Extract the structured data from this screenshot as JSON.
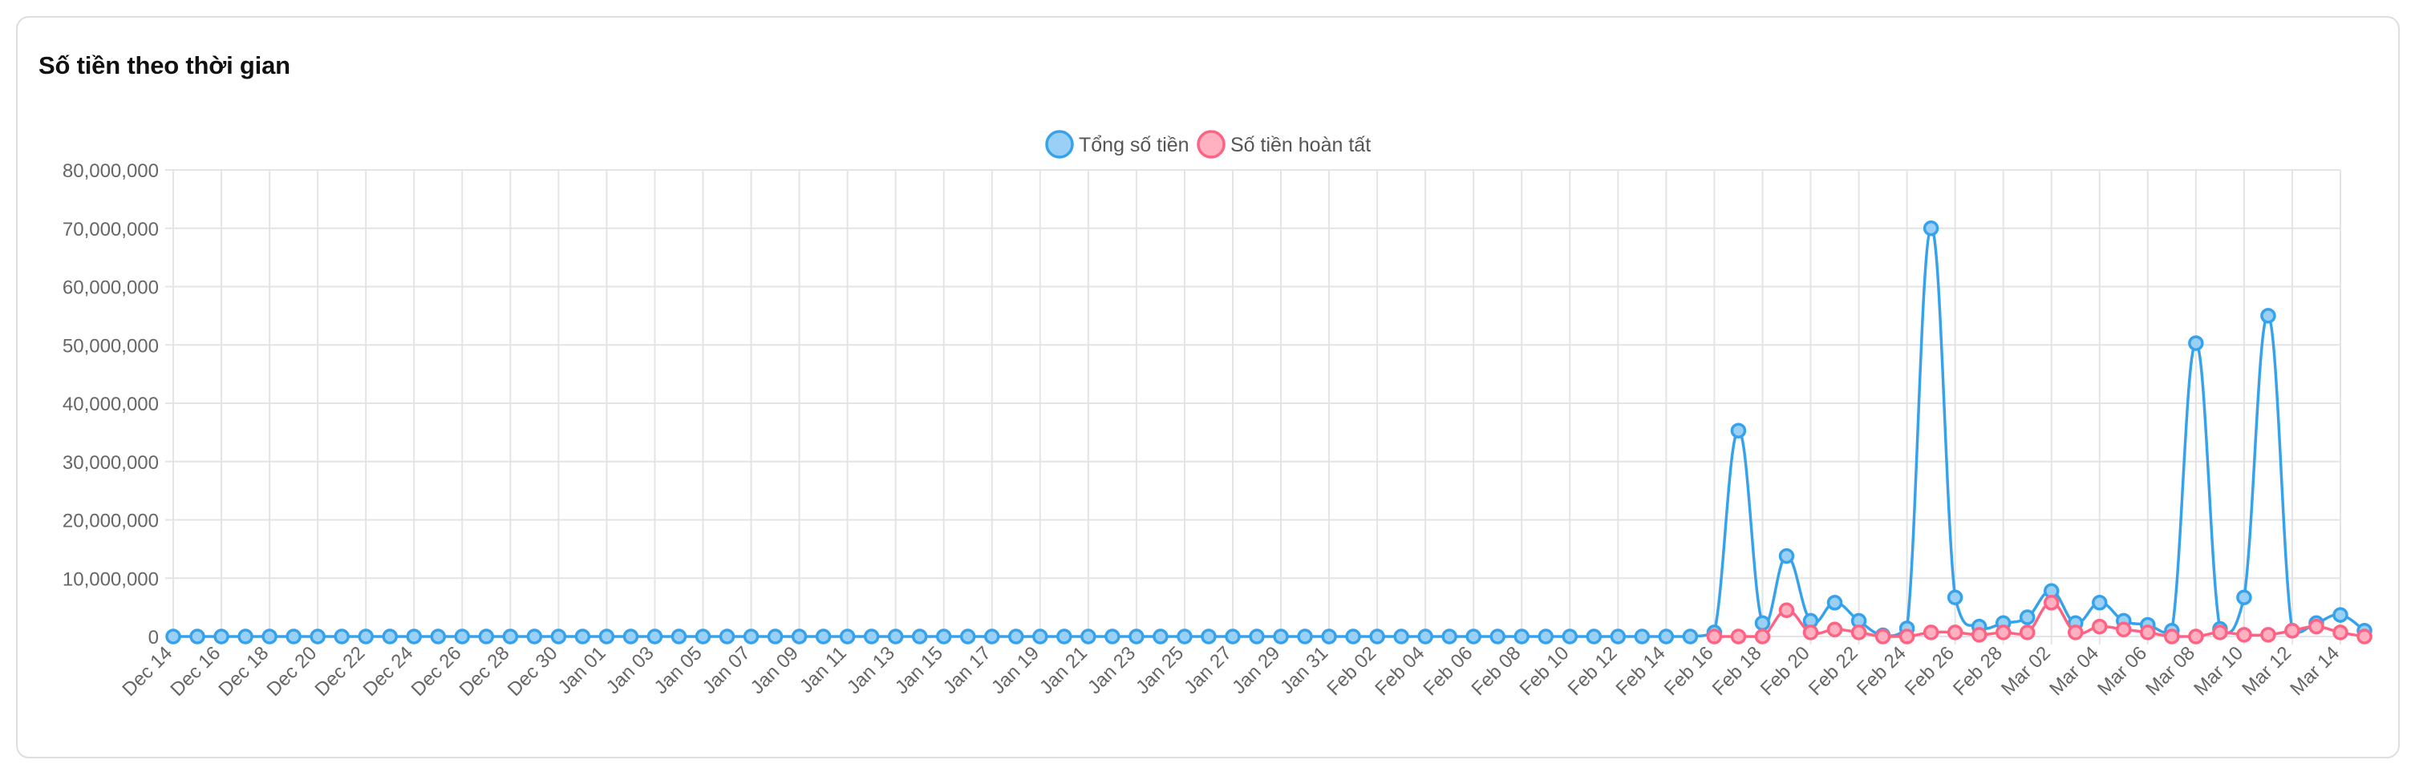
{
  "card": {
    "title": "Số tiền theo thời gian"
  },
  "chart_data": {
    "type": "line",
    "title": "",
    "xlabel": "",
    "ylabel": "",
    "ylim": [
      0,
      80000000
    ],
    "yticks": [
      "0",
      "10,000,000",
      "20,000,000",
      "30,000,000",
      "40,000,000",
      "50,000,000",
      "60,000,000",
      "70,000,000",
      "80,000,000"
    ],
    "grid": true,
    "legend": "top-center",
    "x": [
      "Dec 14",
      "Dec 15",
      "Dec 16",
      "Dec 17",
      "Dec 18",
      "Dec 19",
      "Dec 20",
      "Dec 21",
      "Dec 22",
      "Dec 23",
      "Dec 24",
      "Dec 25",
      "Dec 26",
      "Dec 27",
      "Dec 28",
      "Dec 29",
      "Dec 30",
      "Dec 31",
      "Jan 01",
      "Jan 02",
      "Jan 03",
      "Jan 04",
      "Jan 05",
      "Jan 06",
      "Jan 07",
      "Jan 08",
      "Jan 09",
      "Jan 10",
      "Jan 11",
      "Jan 12",
      "Jan 13",
      "Jan 14",
      "Jan 15",
      "Jan 16",
      "Jan 17",
      "Jan 18",
      "Jan 19",
      "Jan 20",
      "Jan 21",
      "Jan 22",
      "Jan 23",
      "Jan 24",
      "Jan 25",
      "Jan 26",
      "Jan 27",
      "Jan 28",
      "Jan 29",
      "Jan 30",
      "Jan 31",
      "Feb 01",
      "Feb 02",
      "Feb 03",
      "Feb 04",
      "Feb 05",
      "Feb 06",
      "Feb 07",
      "Feb 08",
      "Feb 09",
      "Feb 10",
      "Feb 11",
      "Feb 12",
      "Feb 13",
      "Feb 14",
      "Feb 15",
      "Feb 16",
      "Feb 17",
      "Feb 18",
      "Feb 19",
      "Feb 20",
      "Feb 21",
      "Feb 22",
      "Feb 23",
      "Feb 24",
      "Feb 25",
      "Feb 26",
      "Feb 27",
      "Feb 28",
      "Mar 01",
      "Mar 02",
      "Mar 03",
      "Mar 04",
      "Mar 05",
      "Mar 06",
      "Mar 07",
      "Mar 08",
      "Mar 09",
      "Mar 10",
      "Mar 11",
      "Mar 12",
      "Mar 13",
      "Mar 14"
    ],
    "series": [
      {
        "name": "Tổng số tiền",
        "color": "#36a2eb",
        "fill": "#9ad0f5",
        "values": [
          0,
          0,
          0,
          0,
          0,
          0,
          0,
          0,
          0,
          0,
          0,
          0,
          0,
          0,
          0,
          0,
          0,
          0,
          0,
          0,
          0,
          0,
          0,
          0,
          0,
          0,
          0,
          0,
          0,
          0,
          0,
          0,
          0,
          0,
          0,
          0,
          0,
          0,
          0,
          0,
          0,
          0,
          0,
          0,
          0,
          0,
          0,
          0,
          0,
          0,
          0,
          0,
          0,
          0,
          0,
          0,
          0,
          0,
          0,
          0,
          0,
          0,
          0,
          0,
          700000,
          35300000,
          2300000,
          13800000,
          2700000,
          5800000,
          2700000,
          200000,
          1400000,
          70000000,
          6700000,
          1700000,
          2300000,
          3300000,
          7800000,
          2300000,
          5800000,
          2700000,
          2000000,
          1000000,
          50300000,
          1300000,
          6700000,
          55000000,
          1000000,
          2300000,
          3700000,
          1000000
        ]
      },
      {
        "name": "Số tiền hoàn tất",
        "color": "#ff6384",
        "fill": "#ffb1c1",
        "values": [
          null,
          null,
          null,
          null,
          null,
          null,
          null,
          null,
          null,
          null,
          null,
          null,
          null,
          null,
          null,
          null,
          null,
          null,
          null,
          null,
          null,
          null,
          null,
          null,
          null,
          null,
          null,
          null,
          null,
          null,
          null,
          null,
          null,
          null,
          null,
          null,
          null,
          null,
          null,
          null,
          null,
          null,
          null,
          null,
          null,
          null,
          null,
          null,
          null,
          null,
          null,
          null,
          null,
          null,
          null,
          null,
          null,
          null,
          null,
          null,
          null,
          null,
          null,
          null,
          0,
          0,
          0,
          4500000,
          700000,
          1200000,
          700000,
          0,
          0,
          700000,
          700000,
          300000,
          700000,
          700000,
          5800000,
          700000,
          1700000,
          1200000,
          700000,
          0,
          0,
          700000,
          300000,
          300000,
          1000000,
          1700000,
          700000,
          0
        ]
      }
    ]
  }
}
